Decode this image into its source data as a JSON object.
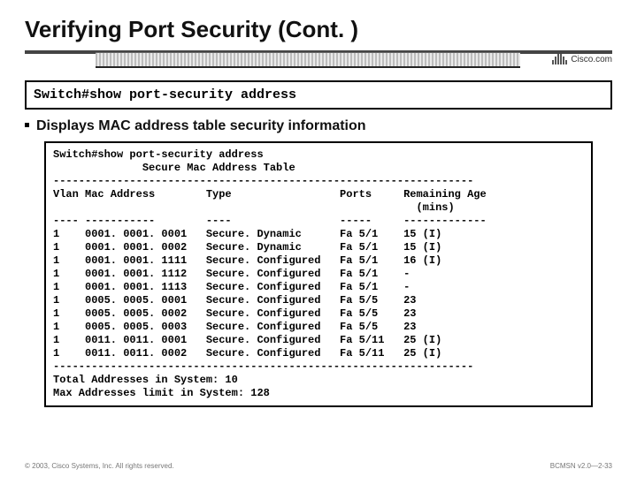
{
  "title": "Verifying Port Security (Cont. )",
  "logo_text": "Cisco.com",
  "command_box": "Switch#show port-security address",
  "bullet": "Displays MAC address table security information",
  "terminal": {
    "prompt": "Switch#",
    "cmd": "show port-security address",
    "subtitle": "Secure Mac Address Table",
    "sep": "------------------------------------------------------------------",
    "headers": {
      "vlan": "Vlan",
      "mac": "Mac Address",
      "type": "Type",
      "ports": "Ports",
      "age1": "Remaining Age",
      "age2": "(mins)"
    },
    "dashes": {
      "vlan": "----",
      "mac": "-----------",
      "type": "----",
      "ports": "-----",
      "age": "-------------"
    },
    "rows": [
      {
        "vlan": "1",
        "mac": "0001. 0001. 0001",
        "type": "Secure. Dynamic",
        "ports": "Fa 5/1",
        "age": "15 (I)"
      },
      {
        "vlan": "1",
        "mac": "0001. 0001. 0002",
        "type": "Secure. Dynamic",
        "ports": "Fa 5/1",
        "age": "15 (I)"
      },
      {
        "vlan": "1",
        "mac": "0001. 0001. 1111",
        "type": "Secure. Configured",
        "ports": "Fa 5/1",
        "age": "16 (I)"
      },
      {
        "vlan": "1",
        "mac": "0001. 0001. 1112",
        "type": "Secure. Configured",
        "ports": "Fa 5/1",
        "age": "-"
      },
      {
        "vlan": "1",
        "mac": "0001. 0001. 1113",
        "type": "Secure. Configured",
        "ports": "Fa 5/1",
        "age": "-"
      },
      {
        "vlan": "1",
        "mac": "0005. 0005. 0001",
        "type": "Secure. Configured",
        "ports": "Fa 5/5",
        "age": "23"
      },
      {
        "vlan": "1",
        "mac": "0005. 0005. 0002",
        "type": "Secure. Configured",
        "ports": "Fa 5/5",
        "age": "23"
      },
      {
        "vlan": "1",
        "mac": "0005. 0005. 0003",
        "type": "Secure. Configured",
        "ports": "Fa 5/5",
        "age": "23"
      },
      {
        "vlan": "1",
        "mac": "0011. 0011. 0001",
        "type": "Secure. Configured",
        "ports": "Fa 5/11",
        "age": "25 (I)"
      },
      {
        "vlan": "1",
        "mac": "0011. 0011. 0002",
        "type": "Secure. Configured",
        "ports": "Fa 5/11",
        "age": "25 (I)"
      }
    ],
    "total_line": "Total Addresses in System: 10",
    "max_line": "Max Addresses limit in System: 128"
  },
  "footer_left": "© 2003, Cisco Systems, Inc. All rights reserved.",
  "footer_right": "BCMSN v2.0—2-33"
}
